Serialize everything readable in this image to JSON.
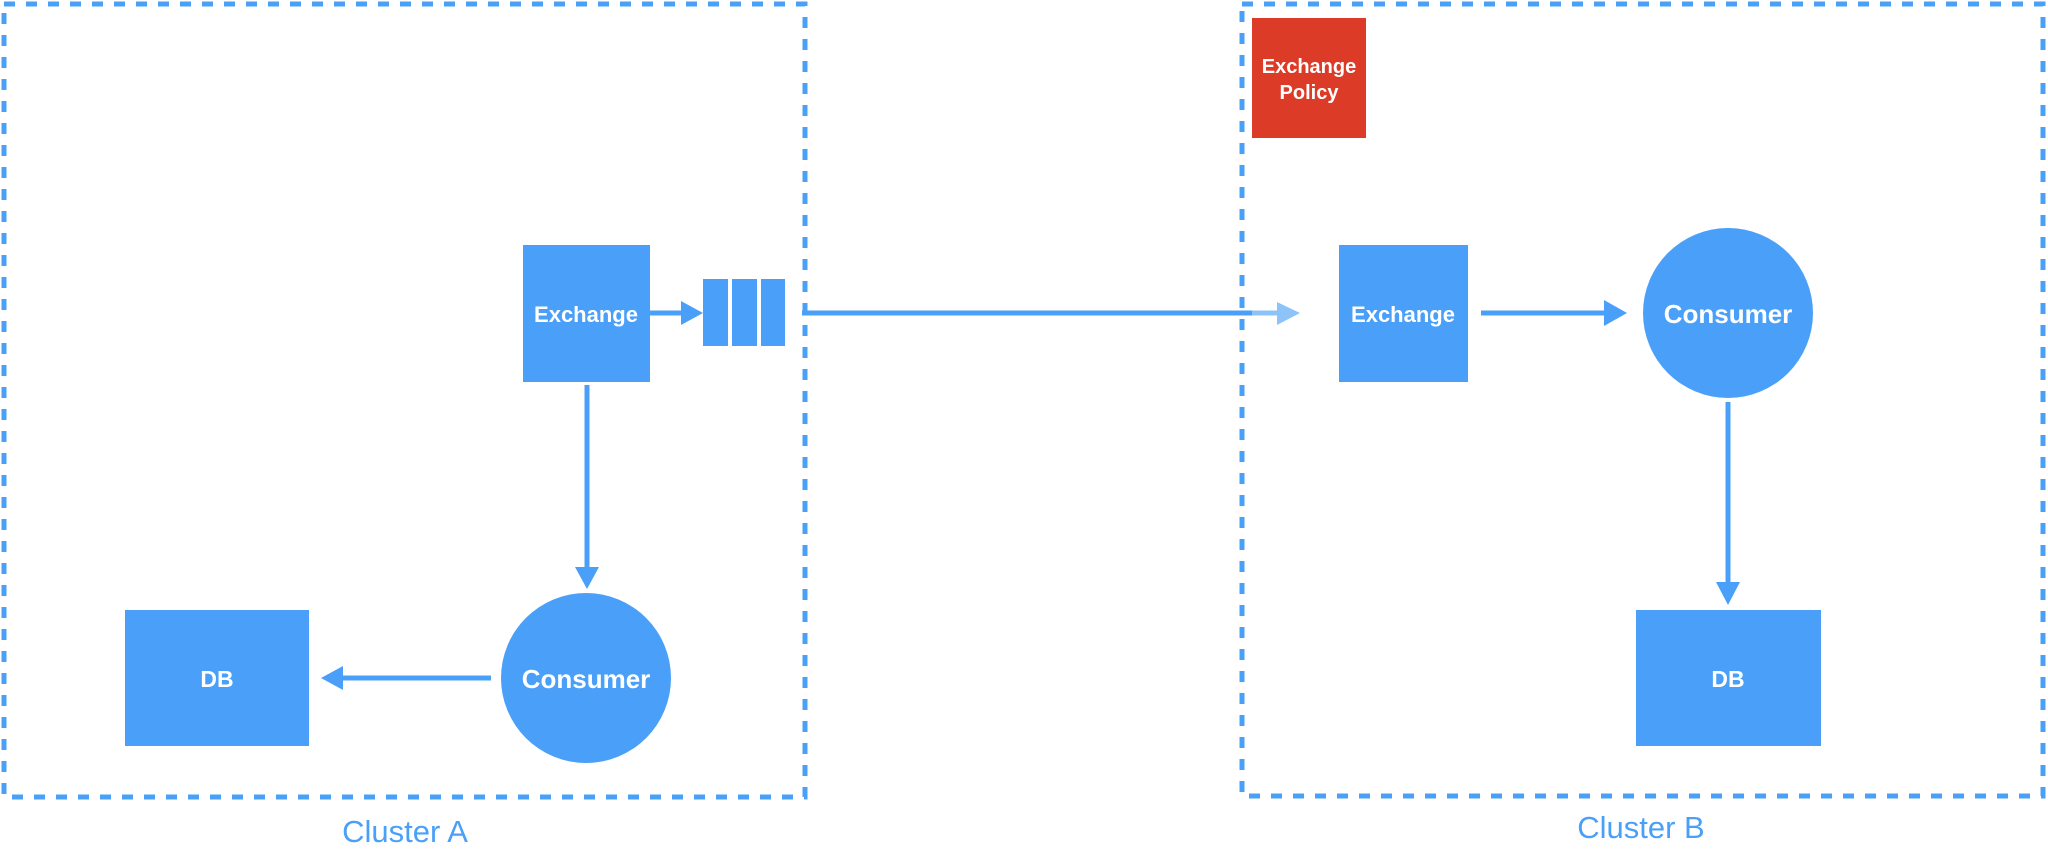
{
  "colors": {
    "primary": "#4aa0f8",
    "faded": "#8ec3fa",
    "policy": "#dc3b27",
    "text_on_node": "#ffffff"
  },
  "clusters": [
    {
      "id": "cluster-a",
      "label": "Cluster A"
    },
    {
      "id": "cluster-b",
      "label": "Cluster B"
    }
  ],
  "cluster_a": {
    "exchange_label": "Exchange",
    "queue_segments": 3,
    "consumer_label": "Consumer",
    "db_label": "DB"
  },
  "cluster_b": {
    "policy_line1": "Exchange",
    "policy_line2": "Policy",
    "exchange_label": "Exchange",
    "consumer_label": "Consumer",
    "db_label": "DB"
  },
  "edges": [
    {
      "from": "Exchange (A)",
      "to": "Queue (A)"
    },
    {
      "from": "Exchange (A)",
      "to": "Consumer (A)"
    },
    {
      "from": "Consumer (A)",
      "to": "DB (A)"
    },
    {
      "from": "Queue (A)",
      "to": "Exchange (B)",
      "style": "federated link, faded near target"
    },
    {
      "from": "Exchange (B)",
      "to": "Consumer (B)"
    },
    {
      "from": "Consumer (B)",
      "to": "DB (B)"
    }
  ]
}
